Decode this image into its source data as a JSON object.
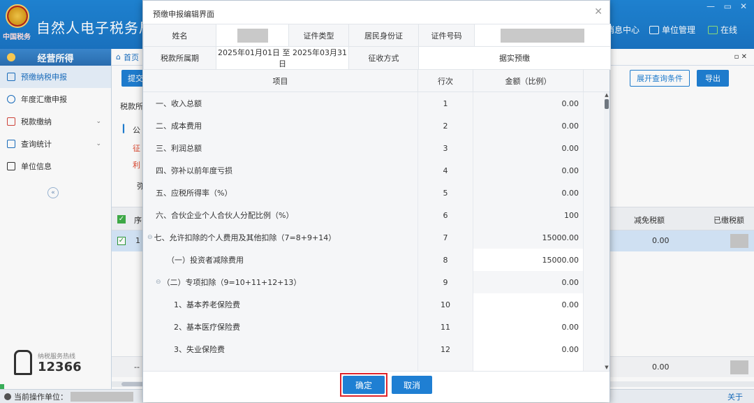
{
  "app": {
    "title": "自然人电子税务局（扣",
    "logo_text": "中国税务",
    "win_min": "—",
    "win_restore": "▭",
    "win_close": "✕",
    "nav": [
      {
        "label": "消息中心"
      },
      {
        "label": "单位管理"
      },
      {
        "label": "在线"
      }
    ]
  },
  "sidebar": {
    "header": "经营所得",
    "items": [
      {
        "label": "预缴纳税申报"
      },
      {
        "label": "年度汇缴申报"
      },
      {
        "label": "税款缴纳"
      },
      {
        "label": "查询统计"
      },
      {
        "label": "单位信息"
      }
    ],
    "collapse": "«",
    "hotline_label": "纳税服务热线",
    "hotline_number": "12366"
  },
  "background": {
    "breadcrumb_home": "首页",
    "close_tab": "▫ ✕",
    "submit_btn": "提交",
    "expand_btn": "展开查询条件",
    "export_btn": "导出",
    "tax_period_frag": "税款所",
    "public_frag": "公",
    "red_frag1": "征",
    "red_frag2": "利",
    "strong_frag": "弥",
    "col_seq": "序",
    "col_reduce": "减免税额",
    "col_paid": "已缴税额",
    "row_seq": "1",
    "row_reduce": "0.00",
    "total_seq": "--",
    "total_reduce": "0.00"
  },
  "modal": {
    "title": "预缴申报编辑界面",
    "close": "✕",
    "info": {
      "name_label": "姓名",
      "id_type_label": "证件类型",
      "id_type_value": "居民身份证",
      "id_no_label": "证件号码",
      "period_label": "税款所属期",
      "period_value": "2025年01月01日 至 2025年03月31日",
      "method_label": "征收方式",
      "method_value": "据实预缴"
    },
    "grid": {
      "headers": {
        "item": "项目",
        "line": "行次",
        "amount": "金额（比例）"
      },
      "rows": [
        {
          "item": "一、收入总额",
          "line": "1",
          "amount": "0.00"
        },
        {
          "item": "二、成本费用",
          "line": "2",
          "amount": "0.00"
        },
        {
          "item": "三、利润总额",
          "line": "3",
          "amount": "0.00"
        },
        {
          "item": "四、弥补以前年度亏损",
          "line": "4",
          "amount": "0.00"
        },
        {
          "item": "五、应税所得率（%）",
          "line": "5",
          "amount": "0.00"
        },
        {
          "item": "六、合伙企业个人合伙人分配比例（%）",
          "line": "6",
          "amount": "100"
        },
        {
          "item": "七、允许扣除的个人费用及其他扣除（7=8+9+14）",
          "line": "7",
          "amount": "15000.00"
        },
        {
          "item": "（一）投资者减除费用",
          "line": "8",
          "amount": "15000.00"
        },
        {
          "item": "（二）专项扣除（9=10+11+12+13）",
          "line": "9",
          "amount": "0.00"
        },
        {
          "item": "1、基本养老保险费",
          "line": "10",
          "amount": "0.00"
        },
        {
          "item": "2、基本医疗保险费",
          "line": "11",
          "amount": "0.00"
        },
        {
          "item": "3、失业保险费",
          "line": "12",
          "amount": "0.00"
        }
      ]
    },
    "ok_btn": "确定",
    "cancel_btn": "取消"
  },
  "footer": {
    "current_unit_label": "当前操作单位：",
    "about": "关于"
  },
  "colors": {
    "primary": "#1f7fd3",
    "header_bg": "#1a74c4",
    "highlight_border": "#e0242b",
    "selected_row": "#d6e8fa"
  }
}
